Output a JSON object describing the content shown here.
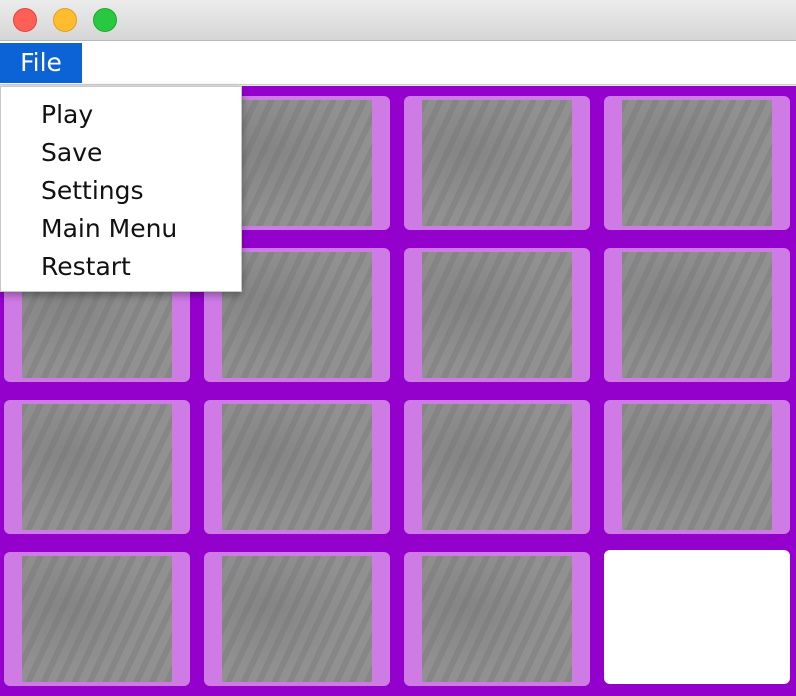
{
  "window": {
    "controls": [
      "close",
      "minimize",
      "maximize"
    ]
  },
  "menubar": {
    "file_label": "File"
  },
  "file_menu": {
    "items": [
      "Play",
      "Save",
      "Settings",
      "Main Menu",
      "Restart"
    ]
  },
  "board": {
    "rows": 4,
    "cols": 4,
    "blank_tile": {
      "row": 4,
      "col": 4
    },
    "image": "tiger-face",
    "colors": {
      "background": "#9400cc",
      "tile_frame": "#cf7be6",
      "blank": "#ffffff"
    }
  }
}
